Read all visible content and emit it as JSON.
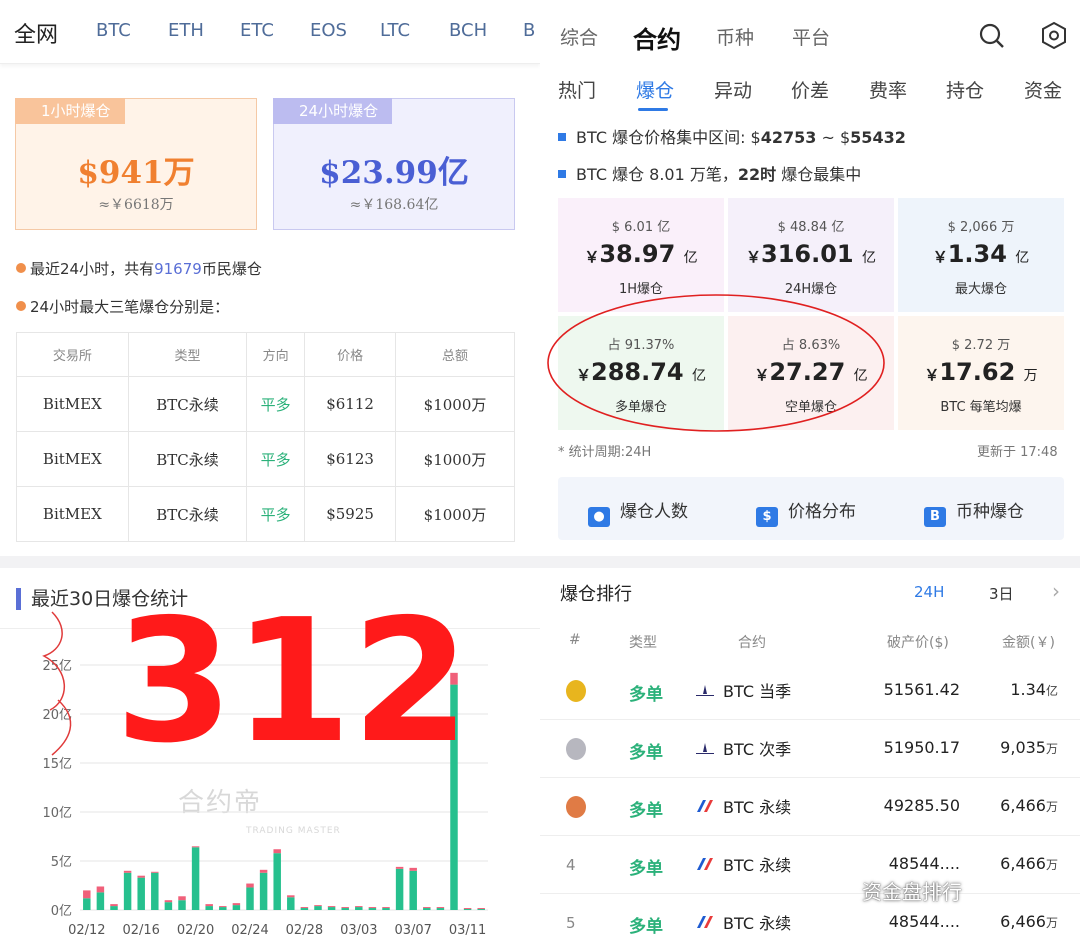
{
  "left": {
    "nav": [
      "全网",
      "BTC",
      "ETH",
      "ETC",
      "EOS",
      "LTC",
      "BCH",
      "B"
    ],
    "card1": {
      "tag": "1小时爆仓",
      "value": "$941万",
      "sub": "≈￥6618万"
    },
    "card2": {
      "tag": "24小时爆仓",
      "value": "$23.99亿",
      "sub": "≈￥168.64亿"
    },
    "line1": {
      "pre": "最近24小时，共有",
      "num": "91679",
      "post": "币民爆仓"
    },
    "line2": "24小时最大三笔爆仓分别是：",
    "table": {
      "headers": [
        "交易所",
        "类型",
        "方向",
        "价格",
        "总额"
      ],
      "rows": [
        [
          "BitMEX",
          "BTC永续",
          "平多",
          "$6112",
          "$1000万"
        ],
        [
          "BitMEX",
          "BTC永续",
          "平多",
          "$6123",
          "$1000万"
        ],
        [
          "BitMEX",
          "BTC永续",
          "平多",
          "$5925",
          "$1000万"
        ]
      ]
    },
    "chart_title": "最近30日爆仓统计",
    "watermark": "合约帝",
    "watermark_sub": "TRADING MASTER",
    "annotation": "312"
  },
  "chart_data": {
    "type": "bar",
    "title": "最近30日爆仓统计",
    "ylabel": "",
    "y_ticks": [
      "0亿",
      "5亿",
      "10亿",
      "15亿",
      "20亿",
      "25亿"
    ],
    "x_ticks": [
      "02/12",
      "02/16",
      "02/20",
      "02/24",
      "02/28",
      "03/03",
      "03/07",
      "03/11"
    ],
    "ylim": [
      0,
      27
    ],
    "categories": [
      "02/12",
      "02/13",
      "02/14",
      "02/15",
      "02/16",
      "02/17",
      "02/18",
      "02/19",
      "02/20",
      "02/21",
      "02/22",
      "02/23",
      "02/24",
      "02/25",
      "02/26",
      "02/27",
      "02/28",
      "03/01",
      "03/02",
      "03/03",
      "03/04",
      "03/05",
      "03/06",
      "03/07",
      "03/08",
      "03/09",
      "03/10",
      "03/11",
      "03/12",
      "03/13"
    ],
    "series": [
      {
        "name": "long",
        "color": "#26c08e",
        "values": [
          1.2,
          1.8,
          0.4,
          3.8,
          3.3,
          3.8,
          0.8,
          1.0,
          6.4,
          0.4,
          0.3,
          0.5,
          2.3,
          3.8,
          5.8,
          1.3,
          0.2,
          0.4,
          0.3,
          0.2,
          0.3,
          0.2,
          0.2,
          4.2,
          4.0,
          0.2,
          0.2,
          23.0,
          0.1,
          0.1
        ]
      },
      {
        "name": "short",
        "color": "#f0607a",
        "values": [
          0.8,
          0.6,
          0.2,
          0.2,
          0.2,
          0.1,
          0.2,
          0.4,
          0.1,
          0.2,
          0.1,
          0.2,
          0.4,
          0.3,
          0.4,
          0.2,
          0.1,
          0.1,
          0.1,
          0.1,
          0.1,
          0.1,
          0.1,
          0.2,
          0.3,
          0.1,
          0.1,
          1.2,
          0.1,
          0.1
        ]
      }
    ]
  },
  "right": {
    "nav": [
      "综合",
      "合约",
      "币种",
      "平台"
    ],
    "subnav": [
      "热门",
      "爆仓",
      "异动",
      "价差",
      "费率",
      "持仓",
      "资金"
    ],
    "info1": {
      "pre": "BTC 爆仓价格集中区间: $",
      "low": "42753",
      "mid": " ~ $",
      "high": "55432"
    },
    "info2": {
      "pre": "BTC 爆仓 8.01 万笔，",
      "hour": "22时",
      "post": " 爆仓最集中"
    },
    "cells": [
      {
        "top": "$ 6.01 亿",
        "value": "38.97",
        "unit": "亿",
        "label": "1H爆仓",
        "bg": "#faf0fa"
      },
      {
        "top": "$ 48.84 亿",
        "value": "316.01",
        "unit": "亿",
        "label": "24H爆仓",
        "bg": "#f5f0fa"
      },
      {
        "top": "$ 2,066 万",
        "value": "1.34",
        "unit": "亿",
        "label": "最大爆仓",
        "bg": "#eef4fb"
      },
      {
        "top": "占 91.37%",
        "value": "288.74",
        "unit": "亿",
        "label": "多单爆仓",
        "bg": "#eef8ef"
      },
      {
        "top": "占 8.63%",
        "value": "27.27",
        "unit": "亿",
        "label": "空单爆仓",
        "bg": "#fcf0f0"
      },
      {
        "top": "$ 2.72 万",
        "value": "17.62",
        "unit": "万",
        "label": "BTC 每笔均爆",
        "bg": "#fdf5ee"
      }
    ],
    "yen": "￥",
    "foot_left": "* 统计周期:24H",
    "foot_right": "更新于 17:48",
    "buttons": [
      {
        "label": "爆仓人数",
        "icon": "users-icon"
      },
      {
        "label": "价格分布",
        "icon": "price-dist-icon"
      },
      {
        "label": "币种爆仓",
        "icon": "coin-b-icon"
      }
    ],
    "rank": {
      "title": "爆仓排行",
      "tabs": [
        "24H",
        "3日"
      ],
      "headers": [
        "#",
        "类型",
        "合约",
        "破产价($)",
        "金额(￥)"
      ],
      "rows": [
        {
          "n": "1",
          "type": "多单",
          "contract": "BTC 当季",
          "price": "51561.42",
          "amount": "1.34",
          "unit": "亿",
          "medal": "#e8b51e",
          "logo": "okex"
        },
        {
          "n": "2",
          "type": "多单",
          "contract": "BTC 次季",
          "price": "51950.17",
          "amount": "9,035",
          "unit": "万",
          "medal": "#b7b7bf",
          "logo": "okex"
        },
        {
          "n": "3",
          "type": "多单",
          "contract": "BTC 永续",
          "price": "49285.50",
          "amount": "6,466",
          "unit": "万",
          "medal": "#e07b45",
          "logo": "bitmex"
        },
        {
          "n": "4",
          "type": "多单",
          "contract": "BTC 永续",
          "price": "48544....",
          "amount": "6,466",
          "unit": "万",
          "medal": "",
          "logo": "bitmex"
        },
        {
          "n": "5",
          "type": "多单",
          "contract": "BTC 永续",
          "price": "48544....",
          "amount": "6,466",
          "unit": "万",
          "medal": "",
          "logo": "bitmex"
        }
      ]
    },
    "wechat": "资金盘排行"
  },
  "colors": {
    "accent": "#2f7ae5",
    "green": "#2bb17a",
    "orange": "#f08f4b",
    "purple": "#5a6fd6",
    "annotation": "#ff1a1a"
  }
}
